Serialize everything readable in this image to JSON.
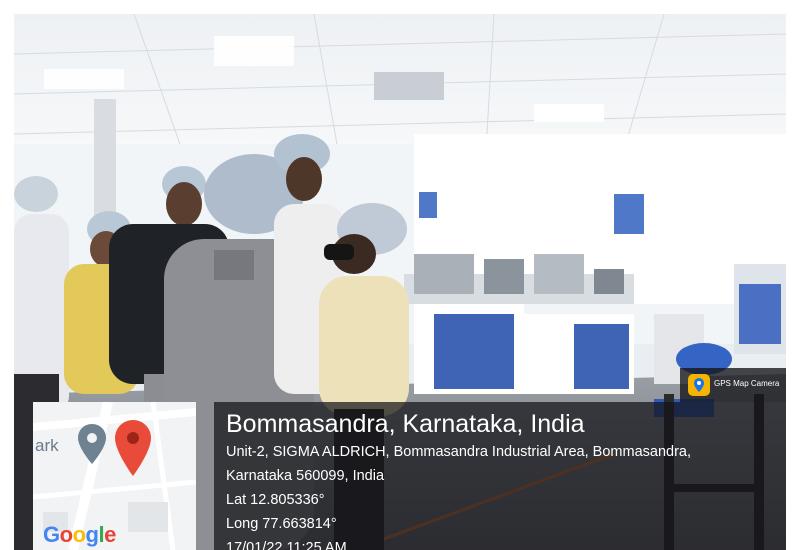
{
  "overlay": {
    "title": "Bommasandra, Karnataka, India",
    "address_line1": "Unit-2, SIGMA ALDRICH, Bommasandra Industrial Area, Bommasandra,",
    "address_line2": "Karnataka 560099, India",
    "latitude": "Lat 12.805336°",
    "longitude": "Long 77.663814°",
    "timestamp": "17/01/22 11:25 AM"
  },
  "map": {
    "logo_letters": [
      "G",
      "o",
      "o",
      "g",
      "l",
      "e"
    ],
    "partial_label": "ark"
  },
  "badge": {
    "app_name": "GPS Map Camera"
  },
  "colors": {
    "google_blue": "#4285F4",
    "google_red": "#EA4335",
    "google_yellow": "#FBBC05",
    "google_green": "#34A853",
    "pin_red": "#e84b3a",
    "pin_gray": "#6f8291"
  },
  "icons": [
    "map-pin-icon",
    "location-pin-icon",
    "app-logo-icon"
  ]
}
